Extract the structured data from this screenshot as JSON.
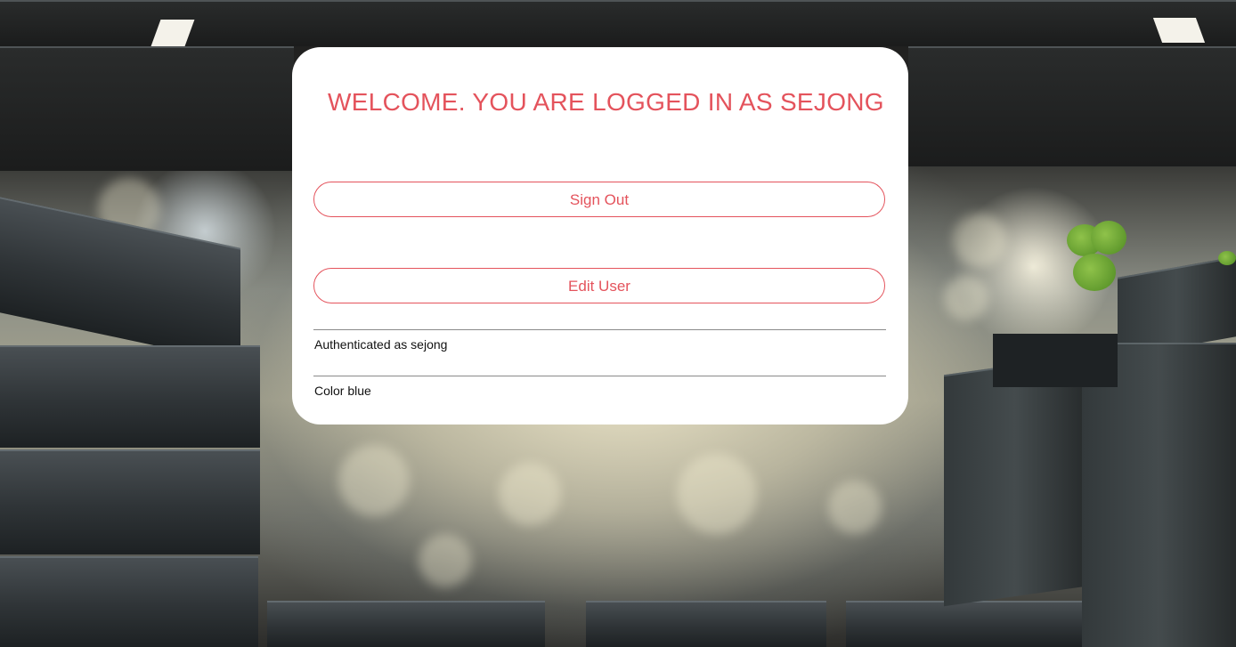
{
  "header": {
    "welcome_title": "WELCOME. YOU ARE LOGGED IN AS SEJONG"
  },
  "actions": {
    "sign_out_label": "Sign Out",
    "edit_user_label": "Edit User"
  },
  "details": {
    "authenticated_text": "Authenticated as sejong",
    "color_text": "Color blue"
  },
  "theme": {
    "accent": "#e4535c",
    "card_background": "#ffffff"
  },
  "background": {
    "image_description_icon": "wooden-crates-photo"
  }
}
